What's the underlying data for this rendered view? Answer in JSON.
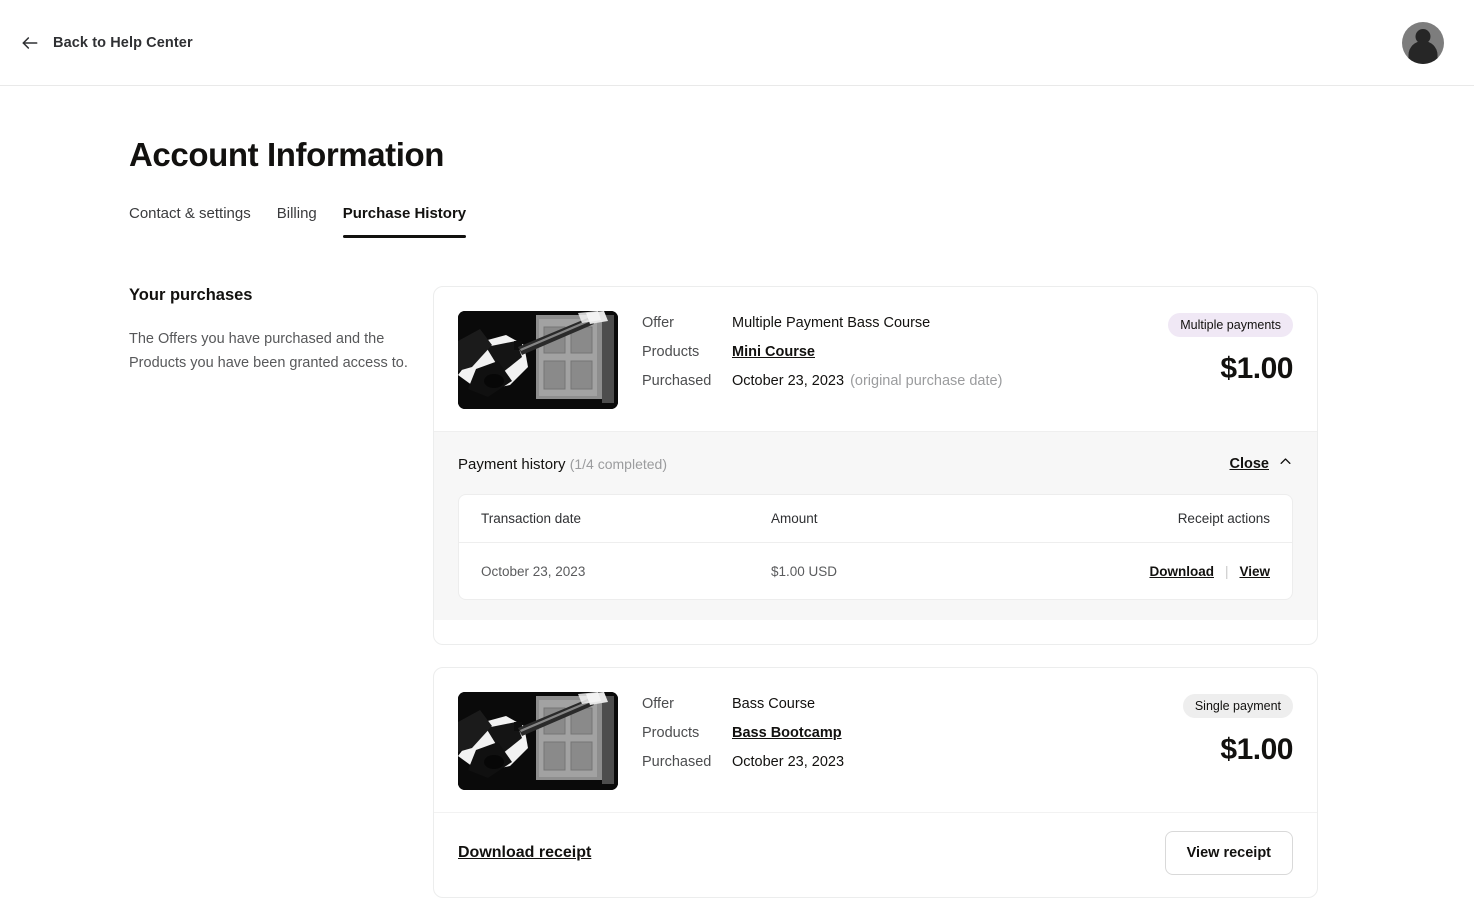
{
  "topbar": {
    "back_label": "Back to Help Center",
    "back_icon": "arrow-left-icon",
    "avatar_icon": "user-avatar"
  },
  "page": {
    "title": "Account Information",
    "tabs": [
      {
        "label": "Contact & settings",
        "active": false
      },
      {
        "label": "Billing",
        "active": false
      },
      {
        "label": "Purchase History",
        "active": true
      }
    ]
  },
  "sidebar": {
    "heading": "Your purchases",
    "description": "The Offers you have purchased and the Products you have been granted access to."
  },
  "labels": {
    "offer": "Offer",
    "products": "Products",
    "purchased": "Purchased"
  },
  "purchases": [
    {
      "thumb_alt": "bass-guitar-photo",
      "offer": "Multiple Payment Bass Course",
      "product": "Mini Course",
      "purchased_date": "October 23, 2023",
      "purchased_note": "(original purchase date)",
      "badge": "Multiple payments",
      "badge_color": "#f0e8f5",
      "price": "$1.00",
      "history": {
        "title": "Payment history",
        "progress": "(1/4 completed)",
        "close_label": "Close",
        "close_icon": "chevron-up-icon",
        "columns": [
          "Transaction date",
          "Amount",
          "Receipt actions"
        ],
        "rows": [
          {
            "date": "October 23, 2023",
            "amount": "$1.00 USD",
            "download_label": "Download",
            "separator": "|",
            "view_label": "View"
          }
        ]
      }
    },
    {
      "thumb_alt": "bass-guitar-photo",
      "offer": "Bass Course",
      "product": "Bass Bootcamp",
      "purchased_date": "October 23, 2023",
      "purchased_note": "",
      "badge": "Single payment",
      "badge_color": "#eeeeee",
      "price": "$1.00",
      "footer": {
        "download_receipt_label": "Download receipt",
        "view_receipt_label": "View receipt"
      }
    }
  ]
}
